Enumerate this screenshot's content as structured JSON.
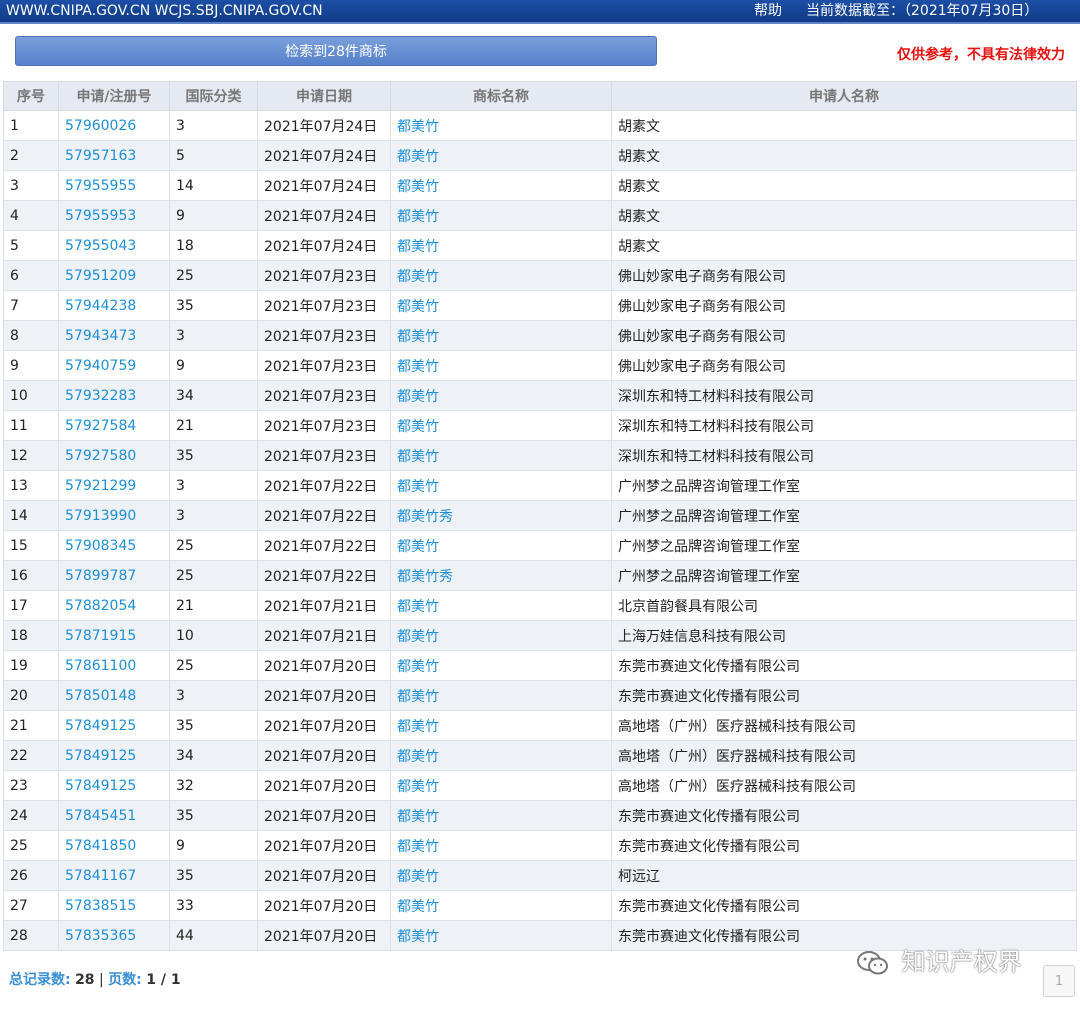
{
  "header": {
    "sites": "WWW.CNIPA.GOV.CN WCJS.SBJ.CNIPA.GOV.CN",
    "help": "帮助",
    "as_of": "当前数据截至：（2021年07月30日）"
  },
  "summary_button": "检索到28件商标",
  "disclaimer": "仅供参考，不具有法律效力",
  "table": {
    "columns": [
      "序号",
      "申请/注册号",
      "国际分类",
      "申请日期",
      "商标名称",
      "申请人名称"
    ],
    "rows": [
      [
        "1",
        "57960026",
        "3",
        "2021年07月24日",
        "都美竹",
        "胡素文"
      ],
      [
        "2",
        "57957163",
        "5",
        "2021年07月24日",
        "都美竹",
        "胡素文"
      ],
      [
        "3",
        "57955955",
        "14",
        "2021年07月24日",
        "都美竹",
        "胡素文"
      ],
      [
        "4",
        "57955953",
        "9",
        "2021年07月24日",
        "都美竹",
        "胡素文"
      ],
      [
        "5",
        "57955043",
        "18",
        "2021年07月24日",
        "都美竹",
        "胡素文"
      ],
      [
        "6",
        "57951209",
        "25",
        "2021年07月23日",
        "都美竹",
        "佛山妙家电子商务有限公司"
      ],
      [
        "7",
        "57944238",
        "35",
        "2021年07月23日",
        "都美竹",
        "佛山妙家电子商务有限公司"
      ],
      [
        "8",
        "57943473",
        "3",
        "2021年07月23日",
        "都美竹",
        "佛山妙家电子商务有限公司"
      ],
      [
        "9",
        "57940759",
        "9",
        "2021年07月23日",
        "都美竹",
        "佛山妙家电子商务有限公司"
      ],
      [
        "10",
        "57932283",
        "34",
        "2021年07月23日",
        "都美竹",
        "深圳东和特工材料科技有限公司"
      ],
      [
        "11",
        "57927584",
        "21",
        "2021年07月23日",
        "都美竹",
        "深圳东和特工材料科技有限公司"
      ],
      [
        "12",
        "57927580",
        "35",
        "2021年07月23日",
        "都美竹",
        "深圳东和特工材料科技有限公司"
      ],
      [
        "13",
        "57921299",
        "3",
        "2021年07月22日",
        "都美竹",
        "广州梦之品牌咨询管理工作室"
      ],
      [
        "14",
        "57913990",
        "3",
        "2021年07月22日",
        "都美竹秀",
        "广州梦之品牌咨询管理工作室"
      ],
      [
        "15",
        "57908345",
        "25",
        "2021年07月22日",
        "都美竹",
        "广州梦之品牌咨询管理工作室"
      ],
      [
        "16",
        "57899787",
        "25",
        "2021年07月22日",
        "都美竹秀",
        "广州梦之品牌咨询管理工作室"
      ],
      [
        "17",
        "57882054",
        "21",
        "2021年07月21日",
        "都美竹",
        "北京首韵餐具有限公司"
      ],
      [
        "18",
        "57871915",
        "10",
        "2021年07月21日",
        "都美竹",
        "上海万娃信息科技有限公司"
      ],
      [
        "19",
        "57861100",
        "25",
        "2021年07月20日",
        "都美竹",
        "东莞市赛迪文化传播有限公司"
      ],
      [
        "20",
        "57850148",
        "3",
        "2021年07月20日",
        "都美竹",
        "东莞市赛迪文化传播有限公司"
      ],
      [
        "21",
        "57849125",
        "35",
        "2021年07月20日",
        "都美竹",
        "高地塔（广州）医疗器械科技有限公司"
      ],
      [
        "22",
        "57849125",
        "34",
        "2021年07月20日",
        "都美竹",
        "高地塔（广州）医疗器械科技有限公司"
      ],
      [
        "23",
        "57849125",
        "32",
        "2021年07月20日",
        "都美竹",
        "高地塔（广州）医疗器械科技有限公司"
      ],
      [
        "24",
        "57845451",
        "35",
        "2021年07月20日",
        "都美竹",
        "东莞市赛迪文化传播有限公司"
      ],
      [
        "25",
        "57841850",
        "9",
        "2021年07月20日",
        "都美竹",
        "东莞市赛迪文化传播有限公司"
      ],
      [
        "26",
        "57841167",
        "35",
        "2021年07月20日",
        "都美竹",
        "柯远辽"
      ],
      [
        "27",
        "57838515",
        "33",
        "2021年07月20日",
        "都美竹",
        "东莞市赛迪文化传播有限公司"
      ],
      [
        "28",
        "57835365",
        "44",
        "2021年07月20日",
        "都美竹",
        "东莞市赛迪文化传播有限公司"
      ]
    ]
  },
  "footer": {
    "total_label": "总记录数:",
    "total_value": "28",
    "separator": "|",
    "pages_label": "页数:",
    "pages_value": "1 / 1",
    "page_button": "1",
    "watermark": "知识产权界"
  },
  "colors": {
    "header_bg": "#1d4fa6",
    "link": "#1f8fd6",
    "disclaimer": "#e5100f",
    "row_alt": "#eef2f7"
  }
}
